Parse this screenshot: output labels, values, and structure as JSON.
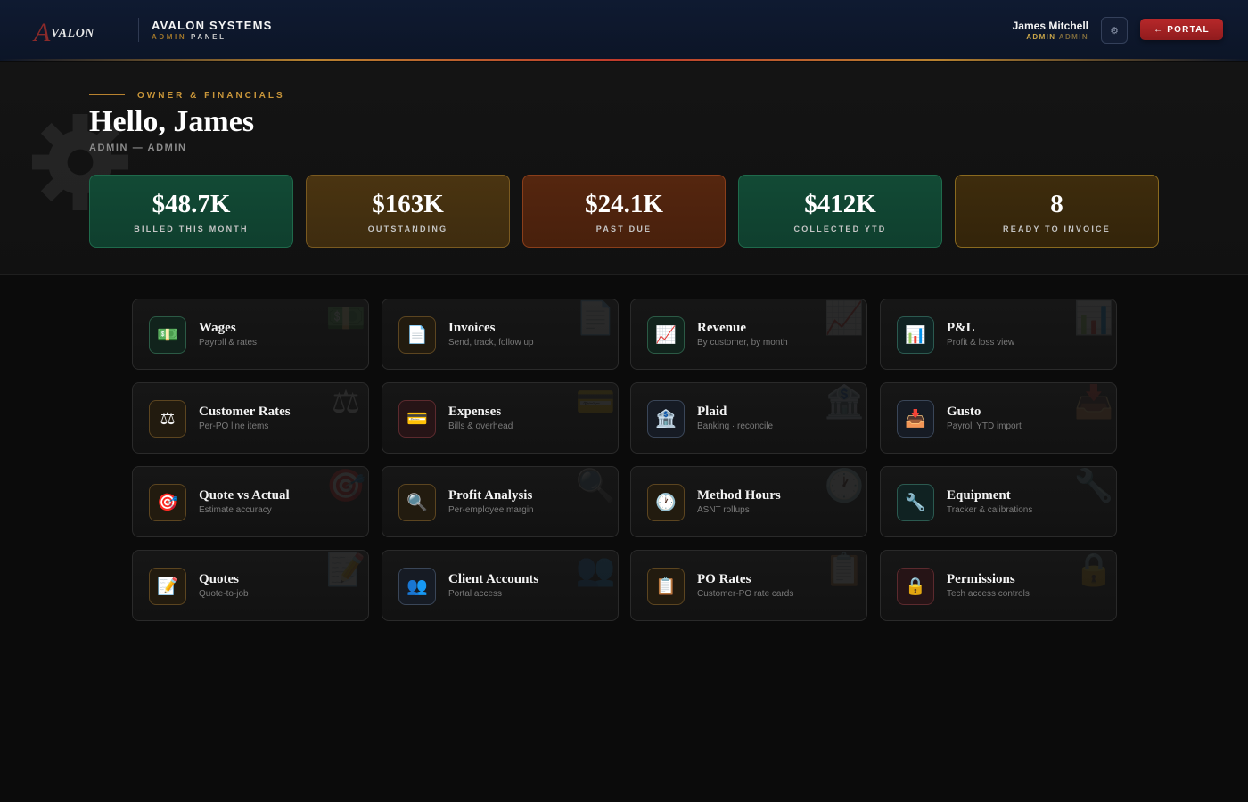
{
  "header": {
    "logo_text": "AVALON",
    "brand_title": "AVALON SYSTEMS",
    "brand_sub_dim": "ADMIN",
    "brand_sub": "PANEL",
    "user_name": "James Mitchell",
    "user_role": "ADMIN",
    "user_role_dim": "ADMIN",
    "settings_icon": "⚙",
    "portal_label": "← PORTAL"
  },
  "hero": {
    "eyebrow": "OWNER & FINANCIALS",
    "greeting": "Hello, James",
    "subtitle": "ADMIN — ADMIN"
  },
  "stats": [
    {
      "value": "$48.7K",
      "label": "BILLED THIS MONTH",
      "color": "#124a35"
    },
    {
      "value": "$163K",
      "label": "OUTSTANDING",
      "color": "#4a3411"
    },
    {
      "value": "$24.1K",
      "label": "PAST DUE",
      "color": "#55260f"
    },
    {
      "value": "$412K",
      "label": "COLLECTED YTD",
      "color": "#124a35"
    },
    {
      "value": "8",
      "label": "READY TO INVOICE",
      "color": "#3e2c0d"
    }
  ],
  "tiles": [
    {
      "title": "Wages",
      "subtitle": "Payroll & rates",
      "icon": "💵",
      "icon_name": "money-icon"
    },
    {
      "title": "Invoices",
      "subtitle": "Send, track, follow up",
      "icon": "📄",
      "icon_name": "document-icon"
    },
    {
      "title": "Revenue",
      "subtitle": "By customer, by month",
      "icon": "📈",
      "icon_name": "chart-up-icon"
    },
    {
      "title": "P&L",
      "subtitle": "Profit & loss view",
      "icon": "📊",
      "icon_name": "bar-chart-icon"
    },
    {
      "title": "Customer Rates",
      "subtitle": "Per-PO line items",
      "icon": "⚖",
      "icon_name": "scale-icon"
    },
    {
      "title": "Expenses",
      "subtitle": "Bills & overhead",
      "icon": "💳",
      "icon_name": "credit-card-icon"
    },
    {
      "title": "Plaid",
      "subtitle": "Banking · reconcile",
      "icon": "🏦",
      "icon_name": "bank-icon"
    },
    {
      "title": "Gusto",
      "subtitle": "Payroll YTD import",
      "icon": "📥",
      "icon_name": "inbox-tray-icon"
    },
    {
      "title": "Quote vs Actual",
      "subtitle": "Estimate accuracy",
      "icon": "🎯",
      "icon_name": "target-icon"
    },
    {
      "title": "Profit Analysis",
      "subtitle": "Per-employee margin",
      "icon": "🔍",
      "icon_name": "magnifier-icon"
    },
    {
      "title": "Method Hours",
      "subtitle": "ASNT rollups",
      "icon": "🕐",
      "icon_name": "clock-icon"
    },
    {
      "title": "Equipment",
      "subtitle": "Tracker & calibrations",
      "icon": "🔧",
      "icon_name": "wrench-icon"
    },
    {
      "title": "Quotes",
      "subtitle": "Quote-to-job",
      "icon": "📝",
      "icon_name": "memo-icon"
    },
    {
      "title": "Client Accounts",
      "subtitle": "Portal access",
      "icon": "👥",
      "icon_name": "users-icon"
    },
    {
      "title": "PO Rates",
      "subtitle": "Customer-PO rate cards",
      "icon": "📋",
      "icon_name": "clipboard-icon"
    },
    {
      "title": "Permissions",
      "subtitle": "Tech access controls",
      "icon": "🔒",
      "icon_name": "lock-icon"
    }
  ]
}
